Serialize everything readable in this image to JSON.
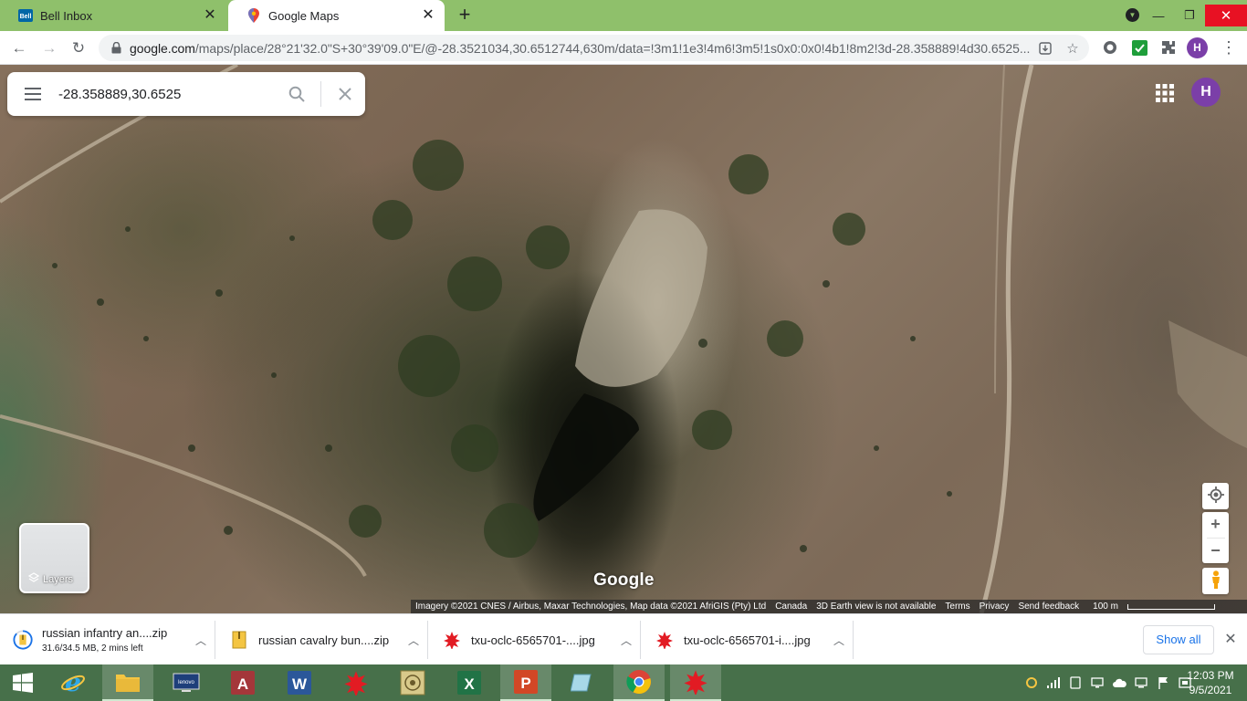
{
  "browser": {
    "tabs": [
      {
        "title": "Bell Inbox",
        "favicon": "bell-icon"
      },
      {
        "title": "Google Maps",
        "favicon": "google-maps-pin-icon"
      }
    ],
    "profile_initial": "H",
    "url_host": "google.com",
    "url_path": "/maps/place/28°21'32.0\"S+30°39'09.0\"E/@-28.3521034,30.6512744,630m/data=!3m1!1e3!4m6!3m5!1s0x0:0x0!4b1!8m2!3d-28.358889!4d30.6525..."
  },
  "maps": {
    "search_value": "-28.358889,30.6525",
    "avatar_initial": "H",
    "layers_label": "Layers",
    "logo_text": "Google",
    "footer": {
      "imagery": "Imagery ©2021 CNES / Airbus, Maxar Technologies, Map data ©2021 AfriGIS (Pty) Ltd",
      "country": "Canada",
      "earth_view": "3D Earth view is not available",
      "terms": "Terms",
      "privacy": "Privacy",
      "feedback": "Send feedback",
      "scale": "100 m"
    }
  },
  "downloads": {
    "items": [
      {
        "name": "russian infantry an....zip",
        "status": "31.6/34.5 MB, 2 mins left",
        "icon": "zip-download-progress-icon"
      },
      {
        "name": "russian cavalry bun....zip",
        "status": "",
        "icon": "zip-icon"
      },
      {
        "name": "txu-oclc-6565701-....jpg",
        "status": "",
        "icon": "image-icon"
      },
      {
        "name": "txu-oclc-6565701-i....jpg",
        "status": "",
        "icon": "image-icon"
      }
    ],
    "show_all": "Show all"
  },
  "taskbar": {
    "time": "12:03 PM",
    "date": "9/5/2021"
  },
  "colors": {
    "tabstrip": "#8fc06b",
    "taskbar": "#47704a",
    "avatar": "#7b3fa8",
    "link": "#1a73e8"
  }
}
